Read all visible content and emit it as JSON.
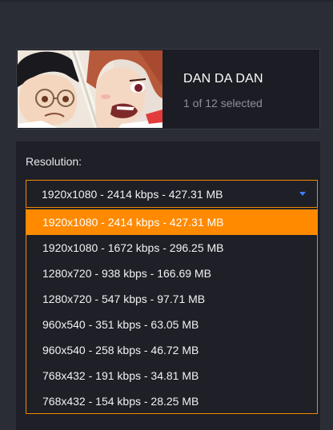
{
  "colors": {
    "page_background": "#2b2d36",
    "panel_background": "#1e1f27",
    "accent_orange": "#ff8a00",
    "dropdown_arrow": "#3b82f6"
  },
  "media": {
    "title": "DAN DA DAN",
    "selection_status": "1 of 12 selected",
    "thumbnail_icon": "anime-thumbnail-image"
  },
  "resolution": {
    "label": "Resolution:",
    "selected_value": "1920x1080 - 2414 kbps - 427.31 MB",
    "arrow_icon": "caret-down-icon",
    "options": [
      "1920x1080 - 2414 kbps - 427.31 MB",
      "1920x1080 - 1672 kbps - 296.25 MB",
      "1280x720 - 938 kbps - 166.69 MB",
      "1280x720 - 547 kbps - 97.71 MB",
      "960x540 - 351 kbps - 63.05 MB",
      "960x540 - 258 kbps - 46.72 MB",
      "768x432 - 191 kbps - 34.81 MB",
      "768x432 - 154 kbps - 28.25 MB"
    ],
    "selected_index": 0
  }
}
